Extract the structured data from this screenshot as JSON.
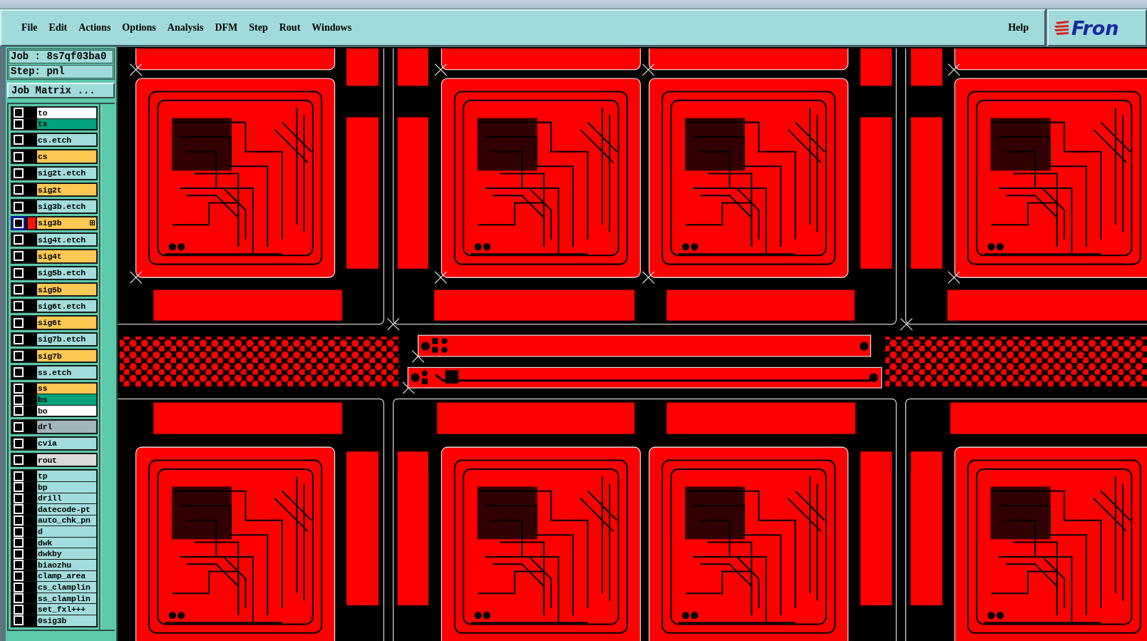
{
  "menu": {
    "items": [
      "File",
      "Edit",
      "Actions",
      "Options",
      "Analysis",
      "DFM",
      "Step",
      "Rout",
      "Windows"
    ],
    "help": "Help",
    "logo": "Fron"
  },
  "job": {
    "job": "Job : 8s7qf03ba0",
    "step": "Step: pnl",
    "matrix_button": "Job Matrix ..."
  },
  "layer_groups": [
    {
      "layers": [
        {
          "name": "to",
          "color": "#ffffff",
          "selected": false,
          "displayed": false
        },
        {
          "name": "ts",
          "color": "#00a27c",
          "selected": false,
          "displayed": false
        }
      ]
    },
    {
      "layers": [
        {
          "name": "cs.etch",
          "color": "#a2dcdc",
          "selected": false,
          "displayed": false
        }
      ]
    },
    {
      "layers": [
        {
          "name": "cs",
          "color": "#ffc852",
          "selected": false,
          "displayed": false
        }
      ]
    },
    {
      "layers": [
        {
          "name": "sig2t.etch",
          "color": "#a2dcdc",
          "selected": false,
          "displayed": false
        }
      ]
    },
    {
      "layers": [
        {
          "name": "sig2t",
          "color": "#ffc852",
          "selected": false,
          "displayed": false
        }
      ]
    },
    {
      "layers": [
        {
          "name": "sig3b.etch",
          "color": "#a2dcdc",
          "selected": false,
          "displayed": false
        }
      ]
    },
    {
      "layers": [
        {
          "name": "sig3b",
          "color": "#ffc852",
          "selected": true,
          "displayed": true
        }
      ]
    },
    {
      "layers": [
        {
          "name": "sig4t.etch",
          "color": "#a2dcdc",
          "selected": false,
          "displayed": false
        }
      ]
    },
    {
      "layers": [
        {
          "name": "sig4t",
          "color": "#ffc852",
          "selected": false,
          "displayed": false
        }
      ]
    },
    {
      "layers": [
        {
          "name": "sig5b.etch",
          "color": "#a2dcdc",
          "selected": false,
          "displayed": false
        }
      ]
    },
    {
      "layers": [
        {
          "name": "sig5b",
          "color": "#ffc852",
          "selected": false,
          "displayed": false
        }
      ]
    },
    {
      "layers": [
        {
          "name": "sig6t.etch",
          "color": "#a2dcdc",
          "selected": false,
          "displayed": false
        }
      ]
    },
    {
      "layers": [
        {
          "name": "sig6t",
          "color": "#ffc852",
          "selected": false,
          "displayed": false
        }
      ]
    },
    {
      "layers": [
        {
          "name": "sig7b.etch",
          "color": "#a2dcdc",
          "selected": false,
          "displayed": false
        }
      ]
    },
    {
      "layers": [
        {
          "name": "sig7b",
          "color": "#ffc852",
          "selected": false,
          "displayed": false
        }
      ]
    },
    {
      "layers": [
        {
          "name": "ss.etch",
          "color": "#a2dcdc",
          "selected": false,
          "displayed": false
        }
      ]
    },
    {
      "layers": [
        {
          "name": "ss",
          "color": "#ffc852",
          "selected": false,
          "displayed": false
        },
        {
          "name": "bs",
          "color": "#00a27c",
          "selected": false,
          "displayed": false
        },
        {
          "name": "bo",
          "color": "#ffffff",
          "selected": false,
          "displayed": false
        }
      ]
    },
    {
      "layers": [
        {
          "name": "drl",
          "color": "#a2b4bc",
          "selected": false,
          "displayed": false
        }
      ]
    },
    {
      "layers": [
        {
          "name": "cvia",
          "color": "#a2dcdc",
          "selected": false,
          "displayed": false
        }
      ]
    },
    {
      "layers": [
        {
          "name": "rout",
          "color": "#dadada",
          "selected": false,
          "displayed": false
        }
      ]
    },
    {
      "layers": [
        {
          "name": "tp",
          "color": "#a2dcdc",
          "selected": false,
          "displayed": false
        },
        {
          "name": "bp",
          "color": "#a2dcdc",
          "selected": false,
          "displayed": false
        },
        {
          "name": "drill",
          "color": "#a2dcdc",
          "selected": false,
          "displayed": false
        },
        {
          "name": "datecode-pt",
          "color": "#a2dcdc",
          "selected": false,
          "displayed": false
        },
        {
          "name": "auto_chk_pn",
          "color": "#a2dcdc",
          "selected": false,
          "displayed": false
        },
        {
          "name": "d",
          "color": "#a2dcdc",
          "selected": false,
          "displayed": false
        },
        {
          "name": "dwk",
          "color": "#a2dcdc",
          "selected": false,
          "displayed": false
        },
        {
          "name": "dwkby",
          "color": "#a2dcdc",
          "selected": false,
          "displayed": false
        },
        {
          "name": "biaozhu",
          "color": "#a2dcdc",
          "selected": false,
          "displayed": false
        },
        {
          "name": "clamp_area",
          "color": "#a2dcdc",
          "selected": false,
          "displayed": false
        },
        {
          "name": "cs_clamplin",
          "color": "#a2dcdc",
          "selected": false,
          "displayed": false
        },
        {
          "name": "ss_clamplin",
          "color": "#a2dcdc",
          "selected": false,
          "displayed": false
        },
        {
          "name": "set_fxl+++",
          "color": "#a2dcdc",
          "selected": false,
          "displayed": false
        },
        {
          "name": "0sig3b",
          "color": "#a2dcdc",
          "selected": false,
          "displayed": false
        }
      ]
    }
  ]
}
